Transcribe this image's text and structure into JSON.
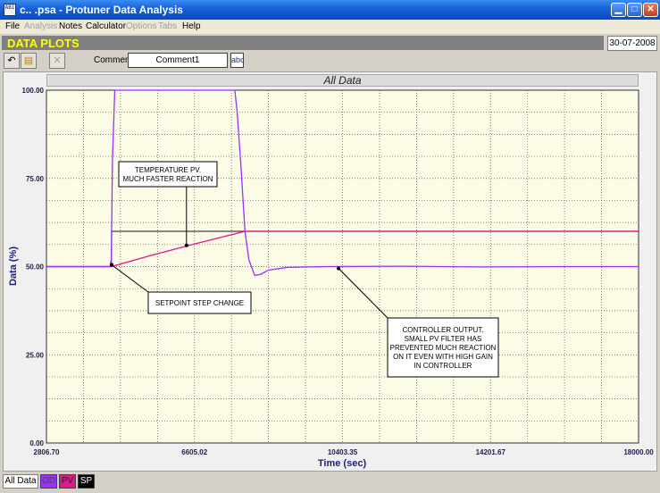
{
  "window": {
    "title": "c.. .psa - Protuner Data  Analysis",
    "icon_text": "AB1",
    "minimize_icon": "minimize-icon",
    "maximize_icon": "maximize-icon",
    "close_icon": "close-icon"
  },
  "menu": {
    "items": [
      {
        "label": "File",
        "enabled": true
      },
      {
        "label": "Analysis",
        "enabled": false
      },
      {
        "label": "Notes",
        "enabled": true
      },
      {
        "label": "Calculator",
        "enabled": true
      },
      {
        "label": "Options",
        "enabled": false
      },
      {
        "label": "Tabs",
        "enabled": false
      },
      {
        "label": "Help",
        "enabled": true
      }
    ]
  },
  "header": {
    "title": "DATA PLOTS",
    "date": "30-07-2008"
  },
  "toolbar": {
    "undo_icon": "undo-icon",
    "open_icon": "open-folder-icon",
    "delete_icon": "delete-icon",
    "comment_label": "Comment",
    "comment_value": "Comment1",
    "spell_label": "abc"
  },
  "plot": {
    "heading": "All Data"
  },
  "chart_data": {
    "type": "line",
    "title": "All Data",
    "xlabel": "Time (sec)",
    "ylabel": "Data (%)",
    "xlim": [
      2806.7,
      18000.0
    ],
    "ylim": [
      0,
      100
    ],
    "x_tick_labels": [
      "2806.70",
      "6605.02",
      "10403.35",
      "14201.67",
      "18000.00"
    ],
    "y_tick_labels": [
      "0.00",
      "25.00",
      "50.00",
      "75.00",
      "100.00"
    ],
    "grid": true,
    "colors": {
      "od": "#9b30ff",
      "pv": "#e4148c",
      "sp": "#404040",
      "background": "#fbfbe6"
    },
    "series": [
      {
        "name": "SP",
        "x": [
          2806.7,
          4470,
          4480,
          18000
        ],
        "values": [
          50,
          50,
          60,
          60
        ]
      },
      {
        "name": "PV",
        "x": [
          2806.7,
          4470,
          5500,
          6600,
          7900,
          18000
        ],
        "values": [
          50,
          50,
          53.2,
          56.4,
          60,
          60
        ]
      },
      {
        "name": "OD",
        "x": [
          2806.7,
          4440,
          4470,
          4500,
          4560,
          7640,
          7700,
          7800,
          7900,
          8000,
          8150,
          8300,
          8500,
          9000,
          10000,
          12000,
          14000,
          16000,
          18000
        ],
        "values": [
          50,
          50,
          52,
          80,
          100,
          100,
          94,
          78,
          60,
          52,
          47.5,
          47.8,
          49,
          49.8,
          50,
          50.1,
          49.9,
          50,
          50
        ]
      }
    ],
    "annotations": [
      {
        "text": [
          "TEMPERATURE PV.",
          "MUCH FASTER REACTION"
        ],
        "target": [
          6400,
          56
        ]
      },
      {
        "text": [
          "SETPOINT STEP CHANGE"
        ],
        "target": [
          4480,
          50.5
        ]
      },
      {
        "text": [
          "CONTROLLER OUTPUT.",
          "SMALL PV FILTER HAS",
          "PREVENTED MUCH REACTION",
          "ON IT EVEN WITH HIGH GAIN",
          "IN CONTROLLER"
        ],
        "target": [
          10300,
          49.5
        ]
      }
    ]
  },
  "tabs": [
    {
      "label": "All Data"
    },
    {
      "label": "OD"
    },
    {
      "label": "PV"
    },
    {
      "label": "SP"
    }
  ]
}
